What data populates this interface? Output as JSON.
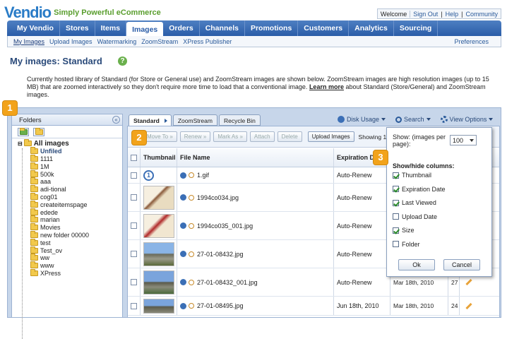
{
  "brand": {
    "logo_text": "Vendio",
    "tagline": "Simply Powerful eCommerce"
  },
  "toplinks": {
    "welcome": "Welcome",
    "signout": "Sign Out",
    "help": "Help",
    "community": "Community"
  },
  "nav": {
    "items": [
      "My Vendio",
      "Stores",
      "Items",
      "Images",
      "Orders",
      "Channels",
      "Promotions",
      "Customers",
      "Analytics",
      "Sourcing"
    ],
    "selected": "Images"
  },
  "subnav": {
    "items": [
      "My Images",
      "Upload Images",
      "Watermarking",
      "ZoomStream",
      "XPress Publisher"
    ],
    "preferences": "Preferences"
  },
  "page": {
    "title": "My images: Standard",
    "help_icon": "?",
    "desc_part1": "Currently hosted library of Standard (for Store or General use) and ZoomStream images are shown below. ZoomStream images are high resolution images (up to 15 MB) that are zoomed interactively so they don't require more time to load that a conventional image. ",
    "desc_link": "Learn more",
    "desc_part2": " about Standard (Store/General) and ZoomStream images."
  },
  "badges": [
    "1",
    "2",
    "3"
  ],
  "folders": {
    "header": "Folders",
    "root": "All images",
    "items": [
      "Unfiled",
      "1111",
      "1M",
      "500k",
      "aaa",
      "adi-tional",
      "cog01",
      "createitemspage",
      "edede",
      "marian",
      "Movies",
      "new folder 00000",
      "test",
      "Test_ov",
      "ww",
      "www",
      "XPress"
    ]
  },
  "tabs": [
    "Standard",
    "ZoomStream",
    "Recycle Bin"
  ],
  "toolright": {
    "disk": "Disk Usage",
    "search": "Search",
    "view": "View Options"
  },
  "buttons": {
    "move": "Move To »",
    "renew": "Renew »",
    "mark": "Mark As »",
    "attach": "Attach",
    "delete": "Delete",
    "upload": "Upload Images",
    "showing": "Showing 1 -"
  },
  "table": {
    "headers": {
      "thumbnail": "Thumbnail",
      "filename": "File Name",
      "expiration": "Expiration D"
    },
    "rows": [
      {
        "name": "1.gif",
        "exp": "Auto-Renew",
        "viewed": "",
        "size": ""
      },
      {
        "name": "1994co034.jpg",
        "exp": "Auto-Renew",
        "viewed": "",
        "size": ""
      },
      {
        "name": "1994co035_001.jpg",
        "exp": "Auto-Renew",
        "viewed": "",
        "size": ""
      },
      {
        "name": "27-01-08432.jpg",
        "exp": "Auto-Renew",
        "viewed": "",
        "size": ""
      },
      {
        "name": "27-01-08432_001.jpg",
        "exp": "Auto-Renew",
        "viewed": "Mar 18th, 2010",
        "size": "27"
      },
      {
        "name": "27-01-08495.jpg",
        "exp": "Jun 18th, 2010",
        "viewed": "Mar 18th, 2010",
        "size": "24"
      }
    ]
  },
  "popup": {
    "show_label": "Show: (images per page):",
    "per_page": "100",
    "columns_label": "Show/hide columns:",
    "columns": [
      {
        "label": "Thumbnail",
        "checked": true
      },
      {
        "label": "Expiration Date",
        "checked": true
      },
      {
        "label": "Last Viewed",
        "checked": true
      },
      {
        "label": "Upload Date",
        "checked": false
      },
      {
        "label": "Size",
        "checked": true
      },
      {
        "label": "Folder",
        "checked": false
      }
    ],
    "ok": "Ok",
    "cancel": "Cancel"
  }
}
